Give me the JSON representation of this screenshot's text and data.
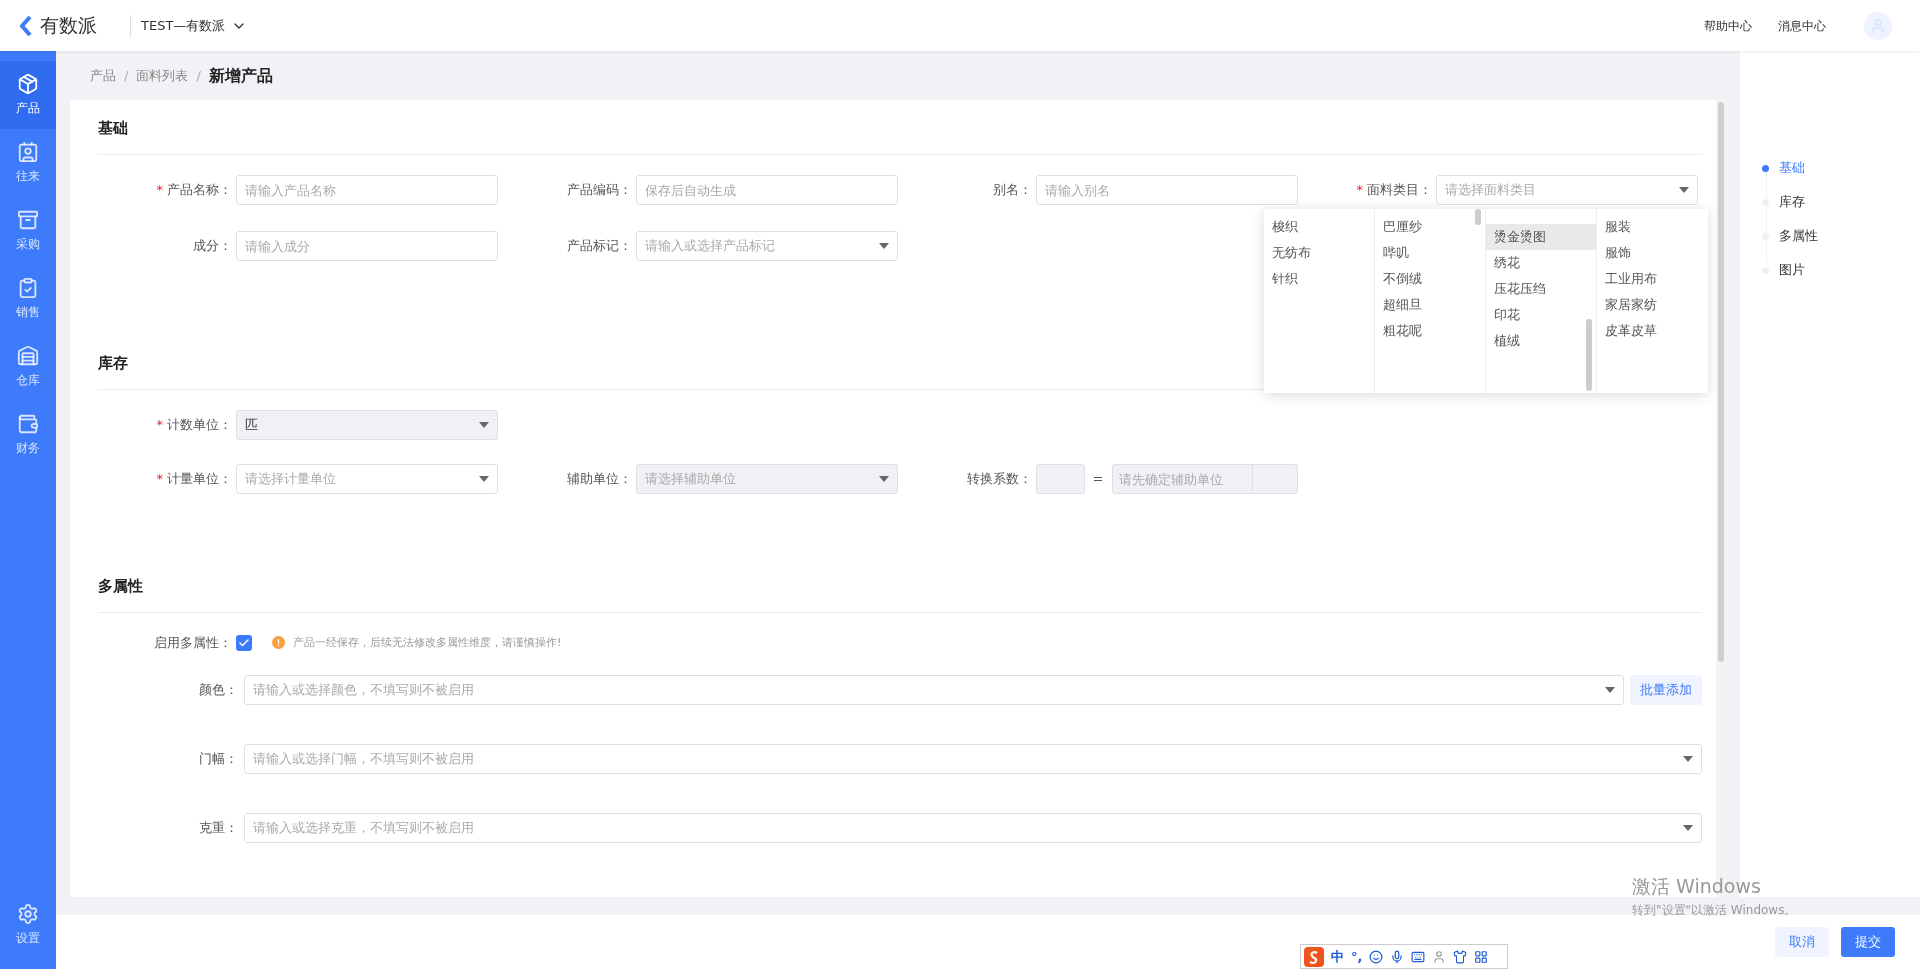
{
  "header": {
    "logo": "有数派",
    "org": "TEST—有数派",
    "links": [
      "帮助中心",
      "消息中心"
    ]
  },
  "sidebar": {
    "items": [
      {
        "label": "产品",
        "selected": true
      },
      {
        "label": "往来",
        "selected": false
      },
      {
        "label": "采购",
        "selected": false
      },
      {
        "label": "销售",
        "selected": false
      },
      {
        "label": "仓库",
        "selected": false
      },
      {
        "label": "财务",
        "selected": false
      }
    ],
    "bottom": {
      "label": "设置",
      "selected": false
    }
  },
  "breadcrumb": {
    "separator": "/",
    "items": [
      "产品",
      "面料列表",
      "新增产品"
    ]
  },
  "sections": [
    {
      "title": "基础",
      "rows": [
        [
          {
            "kind": "text",
            "label": "产品名称：",
            "required_mark": "*",
            "placeholder": "请输入产品名称"
          },
          {
            "kind": "text",
            "label": "产品编码：",
            "placeholder": "保存后自动生成"
          },
          {
            "kind": "text",
            "label": "别名：",
            "placeholder": "请输入别名"
          },
          {
            "kind": "cascade",
            "label": "面料类目：",
            "required_mark": "*",
            "placeholder": "请选择面料类目"
          }
        ],
        [
          {
            "kind": "text",
            "label": "成分：",
            "placeholder": "请输入成分"
          },
          {
            "kind": "select",
            "label": "产品标记：",
            "placeholder": "请输入或选择产品标记",
            "disabled": false
          }
        ]
      ]
    },
    {
      "title": "库存",
      "rows": [
        [
          {
            "kind": "select",
            "label": "计数单位：",
            "required_mark": "*",
            "value": "匹",
            "disabled": true
          }
        ],
        [
          {
            "kind": "select",
            "label": "计量单位：",
            "required_mark": "*",
            "placeholder": "请选择计量单位",
            "disabled": false
          },
          {
            "kind": "select",
            "label": "辅助单位：",
            "placeholder": "请选择辅助单位",
            "disabled": true
          },
          {
            "kind": "ratio",
            "label": "转换系数：",
            "sign": "=",
            "placeholder": "请先确定辅助单位"
          }
        ]
      ]
    },
    {
      "title": "多属性",
      "enable": {
        "label": "启用多属性：",
        "checked": true,
        "warning": "产品一经保存，后续无法修改多属性维度，请谨慎操作!"
      },
      "attributes": [
        {
          "label": "颜色：",
          "placeholder": "请输入或选择颜色，不填写则不被启用",
          "action": "批量添加"
        },
        {
          "label": "门幅：",
          "placeholder": "请输入或选择门幅，不填写则不被启用"
        },
        {
          "label": "克重：",
          "placeholder": "请输入或选择克重，不填写则不被启用"
        }
      ]
    }
  ],
  "cascade": {
    "columns": [
      [
        {
          "label": "梭织",
          "selected": false
        },
        {
          "label": "无纺布",
          "selected": false
        },
        {
          "label": "针织",
          "selected": false
        }
      ],
      [
        {
          "label": "巴厘纱",
          "selected": false
        },
        {
          "label": "哔叽",
          "selected": false
        },
        {
          "label": "不倒绒",
          "selected": false
        },
        {
          "label": "超细旦",
          "selected": false
        },
        {
          "label": "粗花呢",
          "selected": false
        }
      ],
      [
        {
          "label": "烫金烫图",
          "selected": true
        },
        {
          "label": "绣花",
          "selected": false
        },
        {
          "label": "压花压绉",
          "selected": false
        },
        {
          "label": "印花",
          "selected": false
        },
        {
          "label": "植绒",
          "selected": false
        }
      ],
      [
        {
          "label": "服装",
          "selected": false
        },
        {
          "label": "服饰",
          "selected": false
        },
        {
          "label": "工业用布",
          "selected": false
        },
        {
          "label": "家居家纺",
          "selected": false
        },
        {
          "label": "皮革皮草",
          "selected": false
        }
      ]
    ]
  },
  "anchors": [
    {
      "label": "基础",
      "selected": true
    },
    {
      "label": "库存",
      "selected": false
    },
    {
      "label": "多属性",
      "selected": false
    },
    {
      "label": "图片",
      "selected": false
    }
  ],
  "footer": {
    "buttons": [
      {
        "label": "取消",
        "kind": "secondary"
      },
      {
        "label": "提交",
        "kind": "primary"
      }
    ]
  },
  "ime": {
    "texts": [
      "中",
      "°,"
    ]
  },
  "os_notice": [
    "激活 Windows",
    "转到\"设置\"以激活 Windows。"
  ]
}
